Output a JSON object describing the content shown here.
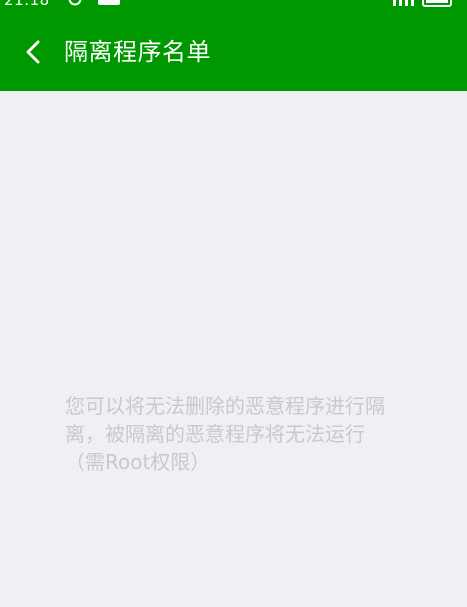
{
  "status_bar": {
    "time": "21:18",
    "icons": [
      "notification-circle-icon",
      "message-icon",
      "signal-icon",
      "battery-icon"
    ]
  },
  "header": {
    "title": "隔离程序名单",
    "back_icon": "chevron-left-icon"
  },
  "colors": {
    "header_bg": "#009800",
    "page_bg": "#f0eff4",
    "empty_text": "#c9c9cd"
  },
  "empty_state": {
    "line1": "您可以将无法删除的恶意程序进行隔",
    "line2": "离，被隔离的恶意程序将无法运行",
    "line3": "（需Root权限）"
  }
}
